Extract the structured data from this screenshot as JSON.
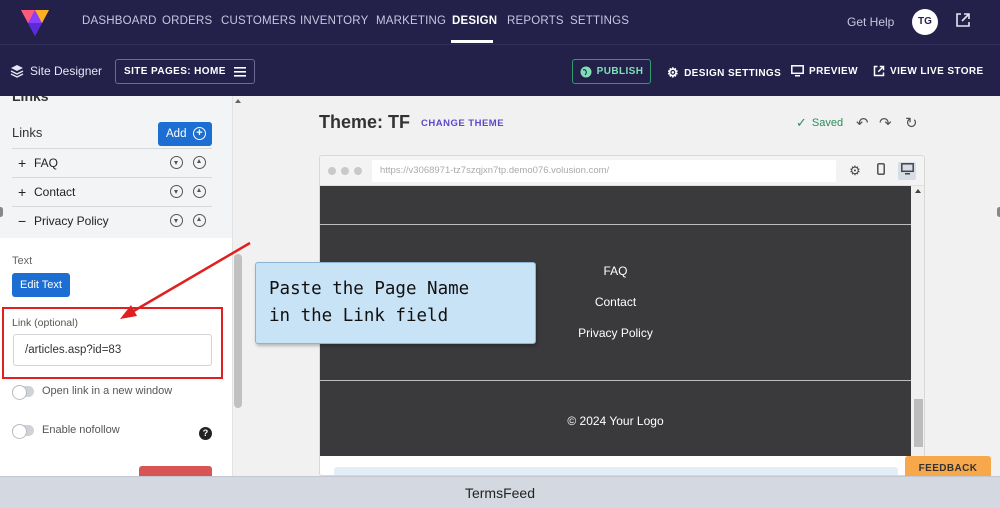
{
  "topnav": {
    "items": [
      "DASHBOARD",
      "ORDERS",
      "CUSTOMERS",
      "INVENTORY",
      "MARKETING",
      "DESIGN",
      "REPORTS",
      "SETTINGS"
    ],
    "active": "DESIGN",
    "get_help": "Get Help",
    "avatar_initials": "TG"
  },
  "toolbar": {
    "title": "Site Designer",
    "pages_button": "SITE PAGES: HOME",
    "publish": "PUBLISH",
    "design_settings": "DESIGN SETTINGS",
    "preview": "PREVIEW",
    "view_live_store": "VIEW LIVE STORE"
  },
  "left_panel": {
    "cut_heading": "Links",
    "links_label": "Links",
    "add_button": "Add",
    "links": [
      {
        "sign": "+",
        "label": "FAQ"
      },
      {
        "sign": "+",
        "label": "Contact"
      },
      {
        "sign": "−",
        "label": "Privacy Policy"
      }
    ],
    "text_label": "Text",
    "edit_text_button": "Edit Text",
    "link_label": "Link (optional)",
    "link_value": "/articles.asp?id=83",
    "open_new_window": "Open link in a new window",
    "enable_nofollow": "Enable nofollow",
    "help_icon": "?"
  },
  "canvas": {
    "theme_title": "Theme: TF",
    "change_theme": "CHANGE THEME",
    "saved": "Saved",
    "url": "https://v3068971-tz7szqjxn7tp.demo076.volusion.com/",
    "footer_links": [
      "FAQ",
      "Contact",
      "Privacy Policy"
    ],
    "copyright": "© 2024 Your Logo"
  },
  "callout": {
    "line1": "Paste the Page Name",
    "line2": "in the Link field"
  },
  "feedback": "FEEDBACK",
  "watermark": "TermsFeed",
  "colors": {
    "nav_bg": "#23204a",
    "primary_blue": "#1c6ed2",
    "annotation_red": "#e02020",
    "callout_bg": "#c9e3f6",
    "site_footer_bg": "#3a3a3d",
    "feedback_orange": "#f7a84a",
    "publish_green": "#2f9c70"
  }
}
